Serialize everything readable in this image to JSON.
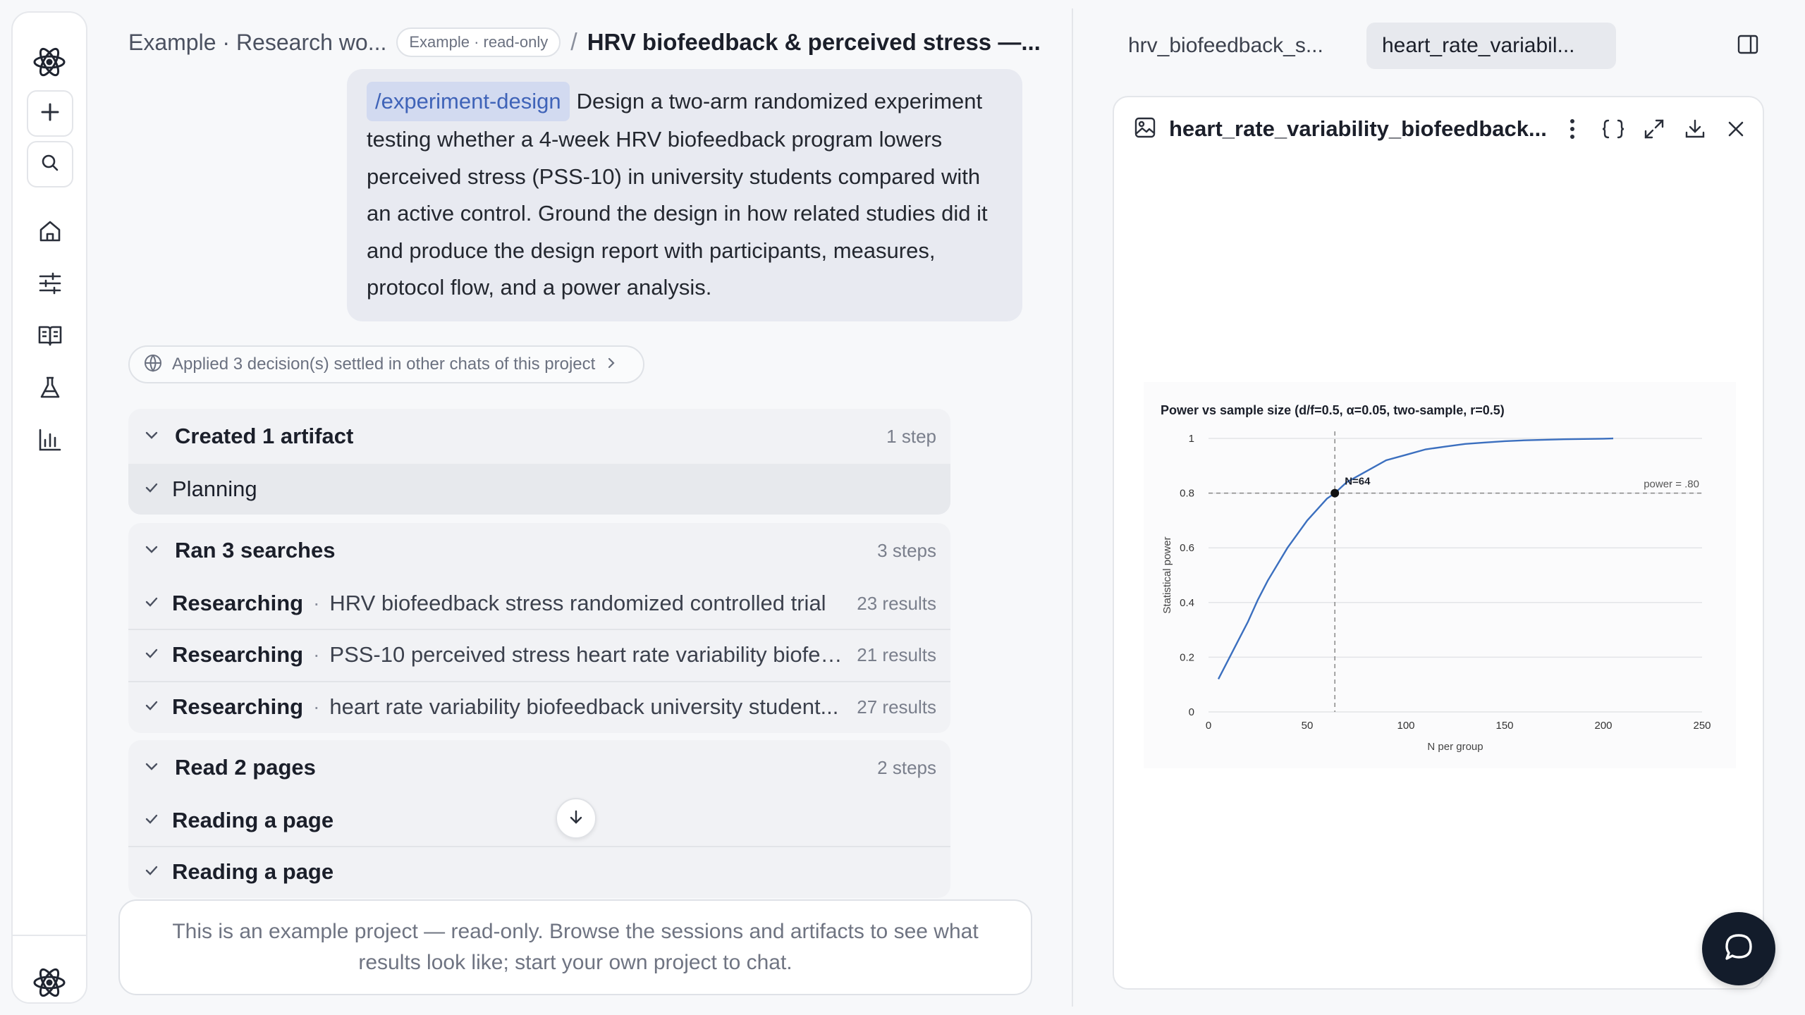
{
  "sidebar": {
    "logo_icon": "atom-icon",
    "new_icon": "plus-icon",
    "search_icon": "search-icon",
    "nav": [
      "home-icon",
      "sliders-icon",
      "book-icon",
      "flask-icon",
      "bar-chart-icon"
    ],
    "footer_icon": "atom-icon"
  },
  "breadcrumb": {
    "project": "Example · Research wo...",
    "badge": "Example · read-only",
    "separator": "/",
    "title": "HRV biofeedback & perceived stress —..."
  },
  "prompt": {
    "command": "/experiment-design",
    "text": "Design a two-arm randomized experiment testing whether a 4-week HRV biofeedback program lowers perceived stress (PSS-10) in university students compared with an active control. Ground the design in how related studies did it and produce the design report with participants, measures, protocol flow, and a power analysis."
  },
  "applied": {
    "text": "Applied 3 decision(s) settled in other chats of this project"
  },
  "groups": [
    {
      "title": "Created 1 artifact",
      "count": "1 step",
      "rows": [
        {
          "label": "Planning"
        }
      ]
    },
    {
      "title": "Ran 3 searches",
      "count": "3 steps",
      "rows": [
        {
          "label": "Researching",
          "query": "HRV biofeedback stress randomized controlled trial",
          "results": "23 results"
        },
        {
          "label": "Researching",
          "query": "PSS-10 perceived stress heart rate variability biofee...",
          "results": "21 results"
        },
        {
          "label": "Researching",
          "query": "heart rate variability biofeedback university student...",
          "results": "27 results"
        }
      ]
    },
    {
      "title": "Read 2 pages",
      "count": "2 steps",
      "rows": [
        {
          "label": "Reading a page"
        },
        {
          "label": "Reading a page"
        }
      ]
    }
  ],
  "composer": {
    "notice": "This is an example project — read-only. Browse the sessions and artifacts to see what results look like; start your own project to chat."
  },
  "tabs": [
    {
      "label": "hrv_biofeedback_s...",
      "active": false
    },
    {
      "label": "heart_rate_variabil...",
      "active": true
    }
  ],
  "artifact": {
    "title": "heart_rate_variability_biofeedback...",
    "icons": [
      "image-icon",
      "more-vertical-icon",
      "code-braces-icon",
      "expand-icon",
      "download-icon",
      "close-icon"
    ]
  },
  "chart_data": {
    "type": "line",
    "title": "Power vs sample size (d/f=0.5, α=0.05, two-sample, r=0.5)",
    "xlabel": "N per group",
    "ylabel": "Statistical power",
    "xlim": [
      0,
      250
    ],
    "ylim": [
      0,
      1
    ],
    "xticks": [
      "0",
      "50",
      "100",
      "150",
      "200",
      "250"
    ],
    "yticks": [
      "0",
      "0.2",
      "0.4",
      "0.6",
      "0.8",
      "1"
    ],
    "grid": true,
    "series": [
      {
        "x": [
          5,
          10,
          15,
          20,
          25,
          30,
          35,
          40,
          45,
          50,
          55,
          60,
          64,
          70,
          80,
          90,
          100,
          110,
          120,
          130,
          140,
          150,
          160,
          170,
          180,
          190,
          200,
          205
        ],
        "y": [
          0.12,
          0.19,
          0.26,
          0.33,
          0.41,
          0.48,
          0.54,
          0.6,
          0.65,
          0.7,
          0.74,
          0.78,
          0.8,
          0.84,
          0.88,
          0.92,
          0.94,
          0.96,
          0.97,
          0.98,
          0.985,
          0.99,
          0.993,
          0.995,
          0.997,
          0.998,
          0.999,
          1.0
        ]
      }
    ],
    "reference_line": {
      "y": 0.8,
      "label": "power = .80"
    },
    "marker": {
      "x": 64,
      "y": 0.8,
      "label": "N=64"
    }
  },
  "fab": {
    "icon": "chat-bubble-icon"
  }
}
